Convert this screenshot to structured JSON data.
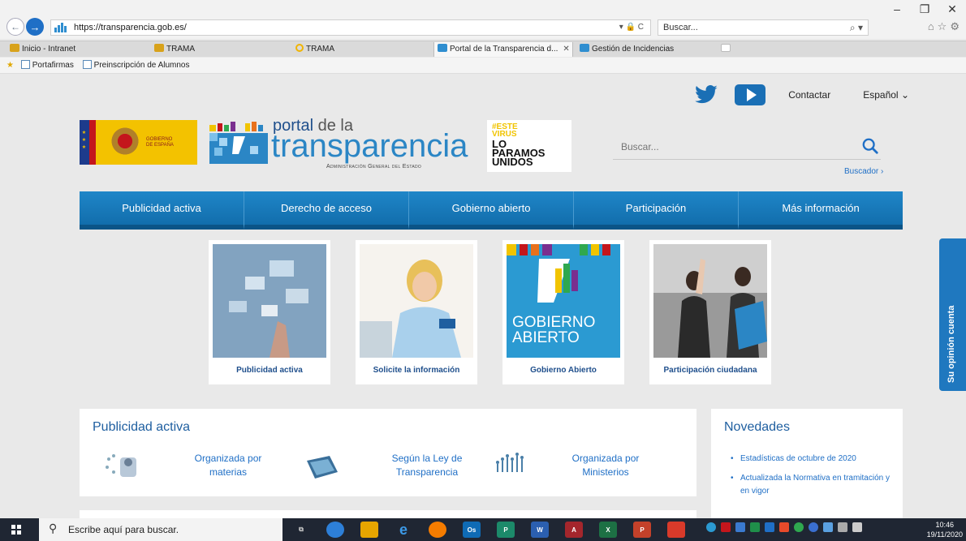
{
  "browser": {
    "url": "https://transparencia.gob.es/",
    "search_placeholder": "Buscar...",
    "tabs": [
      {
        "label": "Inicio - Intranet",
        "icon": "intranet-icon"
      },
      {
        "label": "TRAMA",
        "icon": "trama-icon"
      },
      {
        "label": "TRAMA",
        "icon": "ie-icon"
      },
      {
        "label": "Portal de la Transparencia d...",
        "icon": "portal-icon",
        "active": true
      },
      {
        "label": "Gestión de Incidencias",
        "icon": "incidencias-icon"
      }
    ],
    "favorites": [
      "Portafirmas",
      "Preinscripción de Alumnos"
    ]
  },
  "header": {
    "contact_label": "Contactar",
    "language_label": "Español",
    "gobierno_text": "GOBIERNO DE ESPAÑA",
    "portal_small": "portal",
    "portal_de_la": "de la",
    "portal_big": "transparencia",
    "portal_sub": "Administración General del Estado",
    "virus_line1": "#ESTE VIRUS",
    "virus_line2": "LO PARAMOS UNIDOS",
    "search_placeholder": "Buscar...",
    "buscador_link": "Buscador ›"
  },
  "nav": {
    "items": [
      "Publicidad activa",
      "Derecho de acceso",
      "Gobierno abierto",
      "Participación",
      "Más información"
    ]
  },
  "cards": [
    {
      "label": "Publicidad activa"
    },
    {
      "label": "Solicite la información"
    },
    {
      "label": "Gobierno Abierto",
      "image_text": "GOBIERNO ABIERTO"
    },
    {
      "label": "Participación ciudadana"
    }
  ],
  "publicidad": {
    "title": "Publicidad activa",
    "items": [
      {
        "line1": "Organizada por",
        "line2": "materias"
      },
      {
        "line1": "Según la Ley de",
        "line2": "Transparencia"
      },
      {
        "line1": "Organizada por",
        "line2": "Ministerios"
      }
    ]
  },
  "novedades": {
    "title": "Novedades",
    "items": [
      "Estadísticas de octubre de 2020",
      "Actualizada la Normativa en tramitación y en vigor"
    ]
  },
  "opinion_tab": "Su opinión cuenta",
  "taskbar": {
    "search_text": "Escribe aquí para buscar.",
    "time": "10:46",
    "date": "19/11/2020"
  },
  "colors": {
    "nav_blue": "#1f86c8",
    "link_blue": "#1f6fc6",
    "title_blue": "#1f5fa0",
    "gob_yellow": "#f3c200"
  }
}
